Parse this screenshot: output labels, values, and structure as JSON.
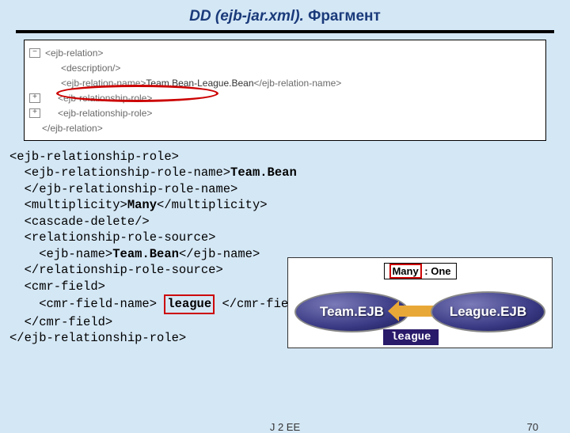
{
  "title": {
    "main": "DD (ejb-jar.xml).",
    "fragment": "Фрагмент"
  },
  "xml_tree": {
    "r0": "<ejb-relation>",
    "r1": "<description/>",
    "r2_open": "<ejb-relation-name>",
    "r2_val": "Team.Bean-League.Bean",
    "r2_close": "</ejb-relation-name>",
    "r3": "<ejb-relationship-role>",
    "r4": "<ejb-relationship-role>",
    "r5": "</ejb-relation>"
  },
  "code": {
    "l0": "<ejb-relationship-role>",
    "l1a": "  <ejb-relationship-role-name>",
    "l1b": "Team.Bean",
    "l2": "  </ejb-relationship-role-name>",
    "l3a": "  <multiplicity>",
    "l3b": "Many",
    "l3c": "</multiplicity>",
    "l4": "  <cascade-delete/>",
    "l5": "  <relationship-role-source>",
    "l6a": "    <ejb-name>",
    "l6b": "Team.Bean",
    "l6c": "</ejb-name>",
    "l7": "  </relationship-role-source>",
    "l8": "  <cmr-field>",
    "l9a": "    <cmr-field-name> ",
    "l9b": "league",
    "l9c": " </cmr-field-name>",
    "l10": "  </cmr-field>",
    "l11": "</ejb-relationship-role>"
  },
  "diagram": {
    "many": "Many",
    "sep": " : ",
    "one": "One",
    "left_ejb": "Team.EJB",
    "right_ejb": "League.EJB",
    "league_label": "league"
  },
  "footer": {
    "course": "J 2 EE",
    "page": "70"
  },
  "icons": {
    "plus": "+",
    "minus": "−"
  }
}
